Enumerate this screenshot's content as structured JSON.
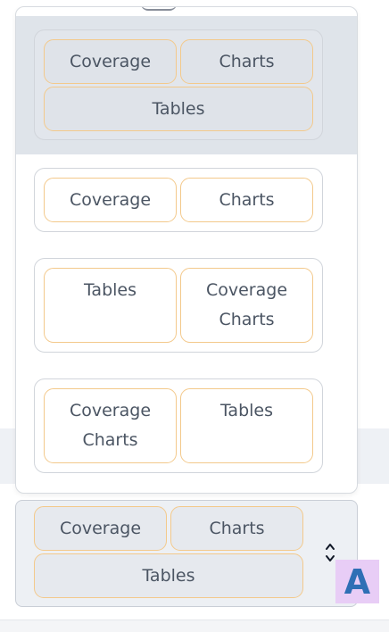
{
  "dropdown": {
    "options": [
      {
        "chips": [
          "Coverage",
          "Charts",
          "Tables"
        ],
        "highlighted": true
      },
      {
        "chips": [
          "Coverage",
          "Charts"
        ]
      },
      {
        "chips": [
          "Tables",
          "Coverage\nCharts"
        ]
      },
      {
        "chips": [
          "Coverage\nCharts",
          "Tables"
        ]
      }
    ]
  },
  "selected": {
    "chips": [
      "Coverage",
      "Charts",
      "Tables"
    ]
  },
  "badge": {
    "letter": "A"
  },
  "colors": {
    "chip_border": "#f3c98b",
    "highlight": "#dfe4ea",
    "badge_bg": "#e8cdf6",
    "badge_fg": "#2f6fb5"
  },
  "icons": {
    "stepper": "chevron-up-down-icon"
  }
}
